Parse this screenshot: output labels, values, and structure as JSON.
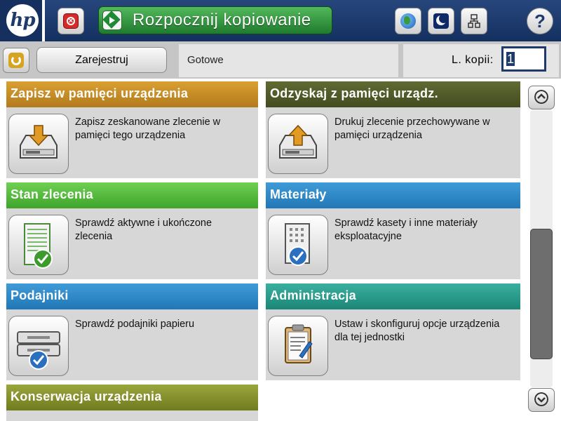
{
  "topbar": {
    "logo_text": "hp",
    "start_copy_label": "Rozpocznij kopiowanie",
    "help_label": "?"
  },
  "statusbar": {
    "register_label": "Zarejestruj",
    "status_text": "Gotowe",
    "copies_label": "L. kopii:",
    "copies_value": "1"
  },
  "tiles": [
    {
      "title": "Zapisz w pamięci urządzenia",
      "desc": "Zapisz zeskanowane zlecenie w pamięci tego urządzenia",
      "icon": "save-to-device-icon",
      "color": "#c58c27"
    },
    {
      "title": "Odzyskaj z pamięci urządz.",
      "desc": "Drukuj zlecenie przechowywane w pamięci urządzenia",
      "icon": "retrieve-from-device-icon",
      "color": "#525c2a"
    },
    {
      "title": "Stan zlecenia",
      "desc": "Sprawdź aktywne i ukończone zlecenia",
      "icon": "job-status-icon",
      "color": "#55bb3c"
    },
    {
      "title": "Materiały",
      "desc": "Sprawdź kasety i inne materiały eksploatacyjne",
      "icon": "supplies-icon",
      "color": "#3189c8"
    },
    {
      "title": "Podajniki",
      "desc": "Sprawdź podajniki papieru",
      "icon": "trays-icon",
      "color": "#3189c8"
    },
    {
      "title": "Administracja",
      "desc": "Ustaw i skonfiguruj opcje urządzenia dla tej jednostki",
      "icon": "administration-icon",
      "color": "#2a9a8a"
    },
    {
      "title": "Konserwacja urządzenia",
      "desc": "",
      "icon": "",
      "color": "#858f2c"
    }
  ]
}
